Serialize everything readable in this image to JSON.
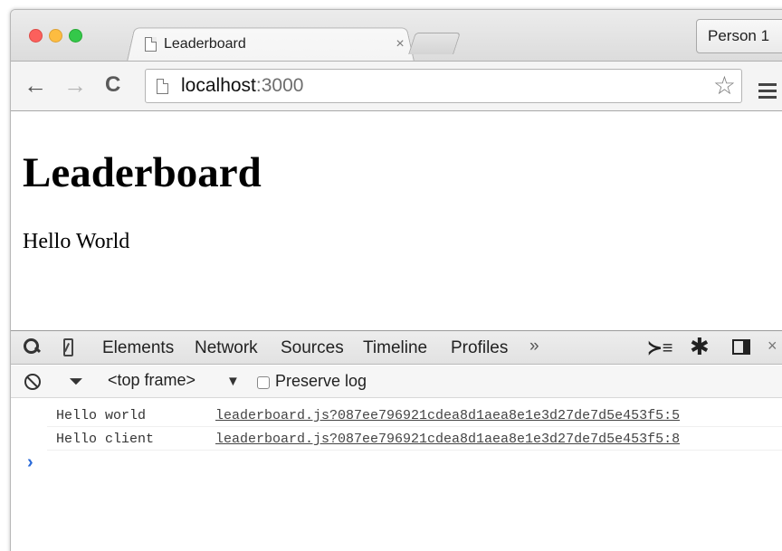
{
  "window": {
    "tab": {
      "title": "Leaderboard",
      "close_glyph": "×"
    },
    "profile": {
      "label": "Person 1"
    }
  },
  "toolbar": {
    "url_host": "localhost",
    "url_port": ":3000",
    "back_glyph": "←",
    "forward_glyph": "→",
    "reload_glyph": "C",
    "star_glyph": "☆"
  },
  "page": {
    "heading": "Leaderboard",
    "body": "Hello World"
  },
  "devtools": {
    "tabs": [
      "Elements",
      "Network",
      "Sources",
      "Timeline",
      "Profiles"
    ],
    "more_glyph": "»",
    "console_glyph": "≻≡",
    "gear_glyph": "✱",
    "close_glyph": "×",
    "filter": {
      "frame_label": "<top frame>",
      "frame_arrow": "▼",
      "preserve_log_label": "Preserve log",
      "preserve_log_checked": false,
      "filter_glyph": "⏷"
    },
    "console": {
      "lines": [
        {
          "message": "Hello world",
          "source": "leaderboard.js?087ee796921cdea8d1aea8e1e3d27de7d5e453f5:5"
        },
        {
          "message": "Hello client",
          "source": "leaderboard.js?087ee796921cdea8d1aea8e1e3d27de7d5e453f5:8"
        }
      ],
      "prompt_glyph": "›"
    }
  },
  "colors": {
    "close_red": "#fc605c",
    "minimize_yellow": "#fdbc40",
    "zoom_green": "#34c84a",
    "console_prompt": "#2a6ad8"
  },
  "icons": [
    "page-icon",
    "star-icon",
    "menu-icon",
    "search-icon",
    "device-icon",
    "console-drawer-icon",
    "gear-icon",
    "dock-icon",
    "clear-icon",
    "filter-icon",
    "prompt-icon"
  ]
}
